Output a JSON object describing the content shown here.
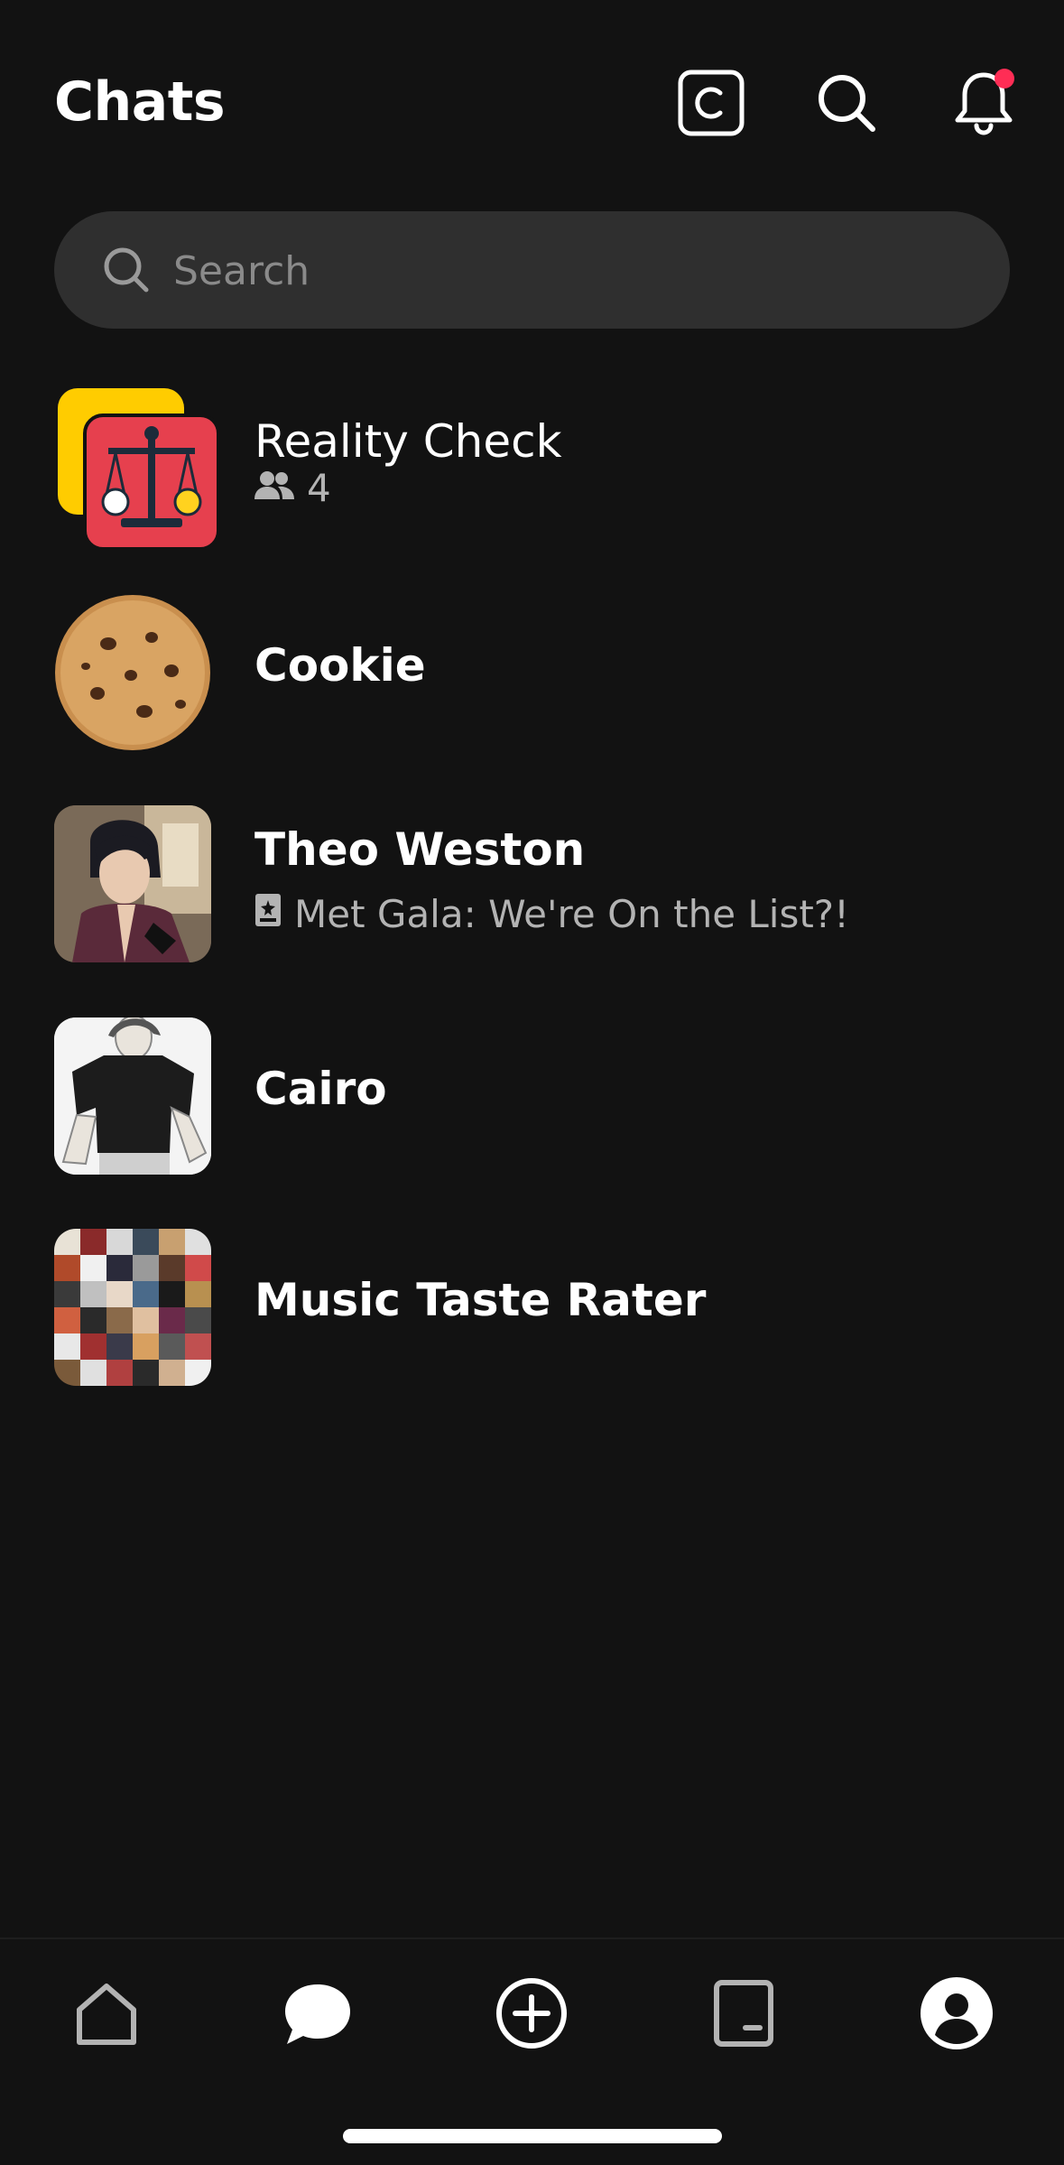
{
  "header": {
    "title": "Chats",
    "icons": [
      "c-badge-icon",
      "search-icon",
      "bell-icon"
    ],
    "notification_dot_color": "#ff2d55"
  },
  "search": {
    "placeholder": "Search",
    "value": ""
  },
  "chats": [
    {
      "name": "Reality Check",
      "member_count": "4",
      "avatar": "scales-icon"
    },
    {
      "name": "Cookie",
      "avatar": "cookie-image"
    },
    {
      "name": "Theo Weston",
      "last_message": "Met Gala: We're On the List?!",
      "avatar": "character-portrait"
    },
    {
      "name": "Cairo",
      "avatar": "character-sketch"
    },
    {
      "name": "Music Taste Rater",
      "avatar": "album-collage"
    }
  ],
  "bottom_nav": {
    "items": [
      "home-icon",
      "chat-bubble-icon",
      "plus-circle-icon",
      "book-icon",
      "profile-icon"
    ],
    "active": "chat-bubble-icon"
  },
  "colors": {
    "background": "#121212",
    "search_bg": "#2f2f2f",
    "accent": "#ff2d55"
  }
}
